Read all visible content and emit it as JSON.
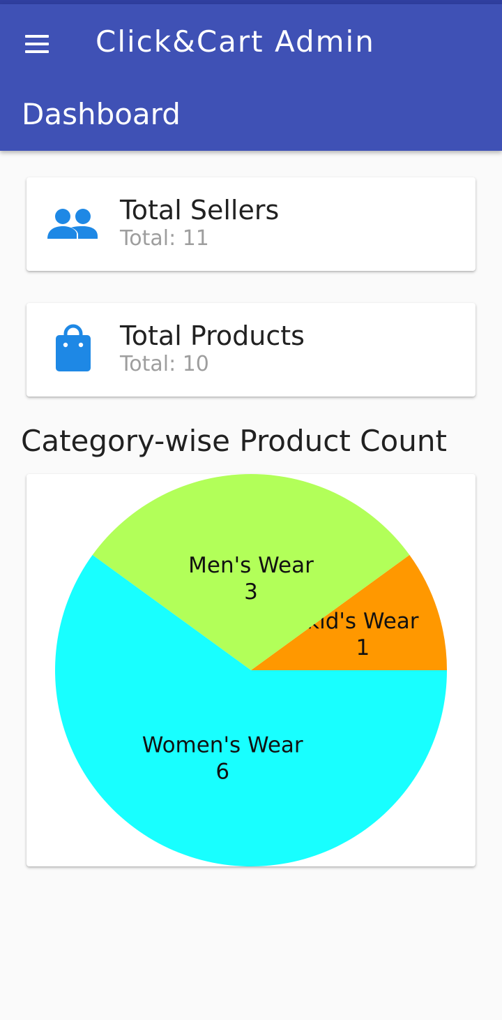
{
  "app_bar": {
    "title": "Click&Cart Admin",
    "page_title": "Dashboard",
    "color": "#3f51b5"
  },
  "cards": [
    {
      "title": "Total Sellers",
      "subtitle": "Total: 11",
      "icon": "people-icon",
      "icon_color": "#1e88e5"
    },
    {
      "title": "Total Products",
      "subtitle": "Total: 10",
      "icon": "shopping-bag-icon",
      "icon_color": "#1e88e5"
    }
  ],
  "section": {
    "title": "Category-wise Product Count"
  },
  "chart_data": {
    "type": "pie",
    "title": "",
    "slices": [
      {
        "label": "kid's Wear",
        "value": 1,
        "color": "#ff9800"
      },
      {
        "label": "Men's Wear",
        "value": 3,
        "color": "#b2ff59"
      },
      {
        "label": "Women's Wear",
        "value": 6,
        "color": "#18ffff"
      }
    ]
  }
}
